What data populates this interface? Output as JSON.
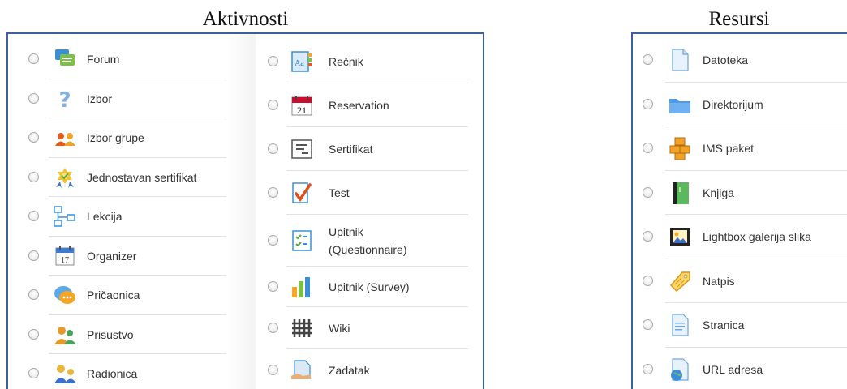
{
  "headings": {
    "activities": "Aktivnosti",
    "resources": "Resursi"
  },
  "activities_left": [
    {
      "label": "Forum",
      "icon": "forum-icon"
    },
    {
      "label": "Izbor",
      "icon": "question-mark-icon"
    },
    {
      "label": "Izbor grupe",
      "icon": "group-choice-icon"
    },
    {
      "label": "Jednostavan sertifikat",
      "icon": "certificate-badge-icon"
    },
    {
      "label": "Lekcija",
      "icon": "lesson-tree-icon"
    },
    {
      "label": "Organizer",
      "icon": "calendar-17-icon"
    },
    {
      "label": "Pričaonica",
      "icon": "chat-bubbles-icon"
    },
    {
      "label": "Prisustvo",
      "icon": "attendance-icon"
    },
    {
      "label": "Radionica",
      "icon": "workshop-icon"
    }
  ],
  "activities_mid": [
    {
      "label": "Rečnik",
      "icon": "glossary-icon"
    },
    {
      "label": "Reservation",
      "icon": "calendar-21-icon"
    },
    {
      "label": "Sertifikat",
      "icon": "certificate-document-icon"
    },
    {
      "label": "Test",
      "icon": "quiz-checkmark-icon"
    },
    {
      "label": "Upitnik (Questionnaire)",
      "icon": "questionnaire-icon"
    },
    {
      "label": "Upitnik (Survey)",
      "icon": "survey-bars-icon"
    },
    {
      "label": "Wiki",
      "icon": "wiki-icon"
    },
    {
      "label": "Zadatak",
      "icon": "assignment-icon"
    }
  ],
  "resources": [
    {
      "label": "Datoteka",
      "icon": "file-icon"
    },
    {
      "label": "Direktorijum",
      "icon": "folder-icon"
    },
    {
      "label": "IMS paket",
      "icon": "ims-package-icon"
    },
    {
      "label": "Knjiga",
      "icon": "book-icon"
    },
    {
      "label": "Lightbox galerija slika",
      "icon": "image-gallery-icon"
    },
    {
      "label": "Natpis",
      "icon": "label-tag-icon"
    },
    {
      "label": "Stranica",
      "icon": "page-icon"
    },
    {
      "label": "URL adresa",
      "icon": "url-globe-icon"
    }
  ],
  "colors": {
    "panel_border": "#3c5fa0",
    "text": "#333333",
    "separator": "#e2e2e2"
  }
}
